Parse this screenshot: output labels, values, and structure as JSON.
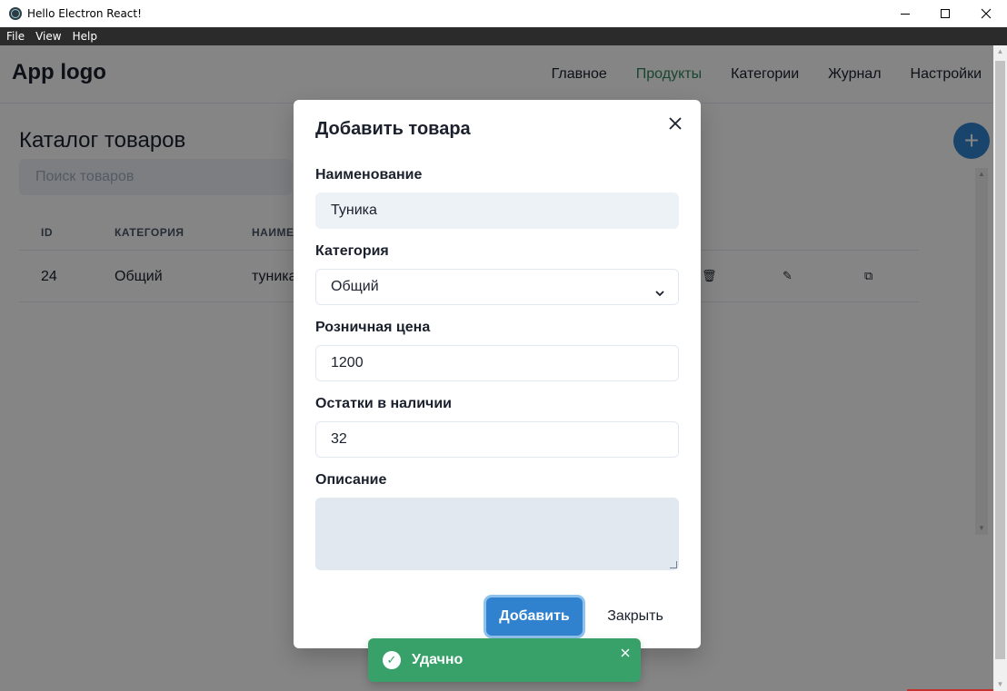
{
  "window": {
    "title": "Hello Electron React!"
  },
  "menubar": {
    "items": [
      "File",
      "View",
      "Help"
    ]
  },
  "header": {
    "logo": "App logo",
    "nav": [
      "Главное",
      "Продукты",
      "Категории",
      "Журнал",
      "Настройки"
    ],
    "active_nav": "Продукты"
  },
  "catalog": {
    "title": "Каталог товаров",
    "search_placeholder": "Поиск товаров",
    "add_button_icon": "plus-icon",
    "columns": [
      "ID",
      "КАТЕГОРИЯ",
      "НАИМЕ"
    ],
    "rows": [
      {
        "id": "24",
        "category": "Общий",
        "name": "туника"
      }
    ],
    "row_actions": [
      "trash-icon",
      "edit-icon",
      "copy-icon"
    ]
  },
  "modal": {
    "title": "Добавить товара",
    "fields": {
      "name": {
        "label": "Наименование",
        "value": "Туника"
      },
      "category": {
        "label": "Категория",
        "value": "Общий"
      },
      "price": {
        "label": "Розничная цена",
        "value": "1200"
      },
      "stock": {
        "label": "Остатки в наличии",
        "value": "32"
      },
      "description": {
        "label": "Описание",
        "value": ""
      }
    },
    "submit_label": "Добавить",
    "close_label": "Закрыть"
  },
  "toast": {
    "text": "Удачно",
    "status": "success"
  },
  "colors": {
    "accent": "#3182ce",
    "active_nav": "#2f855a",
    "success": "#38a169",
    "menubar": "#2b2b2b"
  }
}
